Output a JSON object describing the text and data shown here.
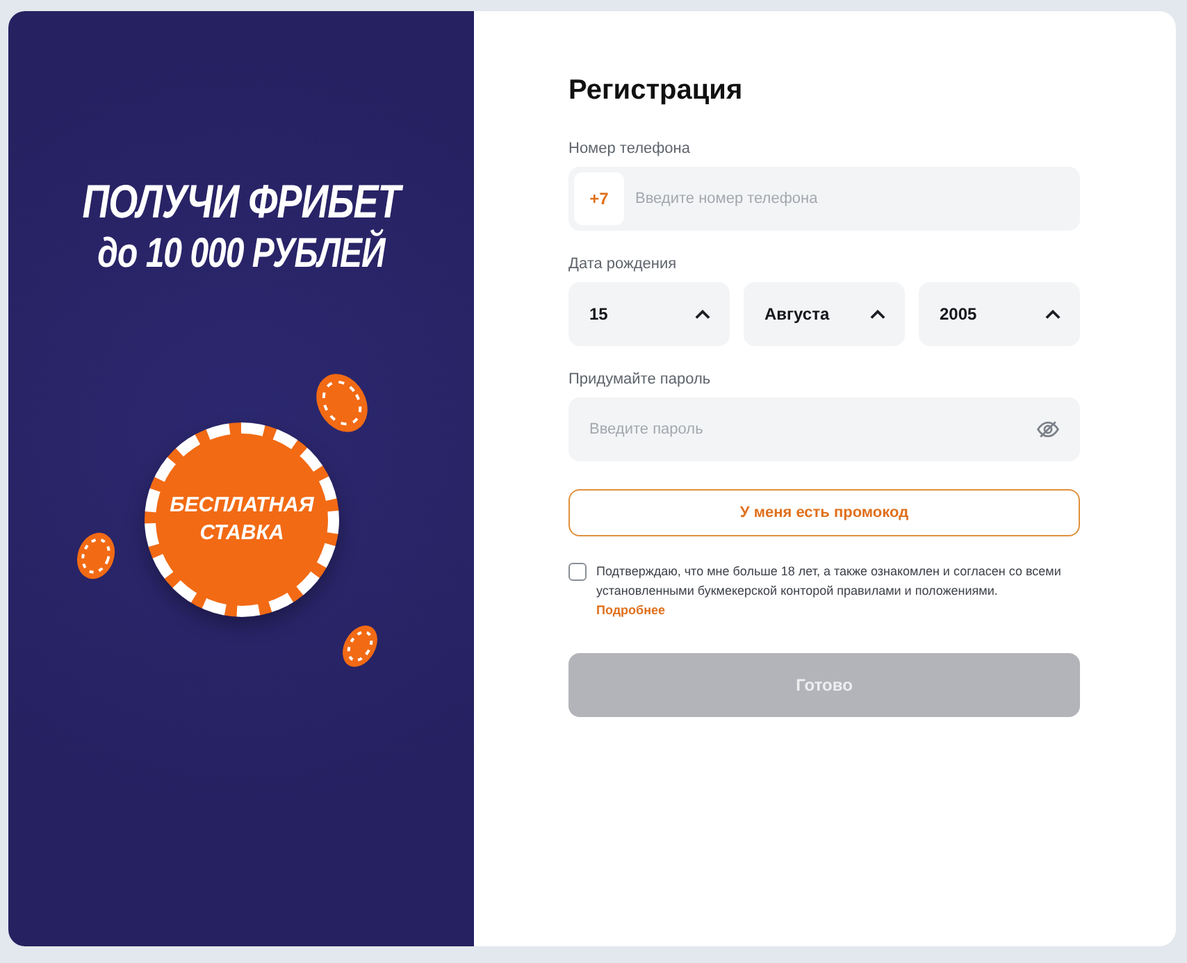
{
  "promo": {
    "headline": "ПОЛУЧИ ФРИБЕТ",
    "subline": "до 10 000 РУБЛЕЙ",
    "chip_text": [
      "БЕСПЛАТНАЯ",
      "СТАВКА"
    ]
  },
  "form": {
    "title": "Регистрация",
    "phone": {
      "label": "Номер телефона",
      "prefix": "+7",
      "placeholder": "Введите номер телефона"
    },
    "birth_date": {
      "label": "Дата рождения",
      "selects": [
        {
          "value": "15"
        },
        {
          "value": "Августа"
        },
        {
          "value": "2005"
        }
      ]
    },
    "password": {
      "label": "Придумайте пароль",
      "placeholder": "Введите пароль"
    },
    "promo_button": "У меня есть промокод",
    "consent": {
      "checked": false,
      "text": "Подтверждаю, что мне больше 18 лет, а также ознакомлен и согласен со всеми установленными букмекерской конторой правилами и положениями.",
      "link": "Подробнее"
    },
    "submit": {
      "label": "Готово",
      "disabled": true
    }
  }
}
